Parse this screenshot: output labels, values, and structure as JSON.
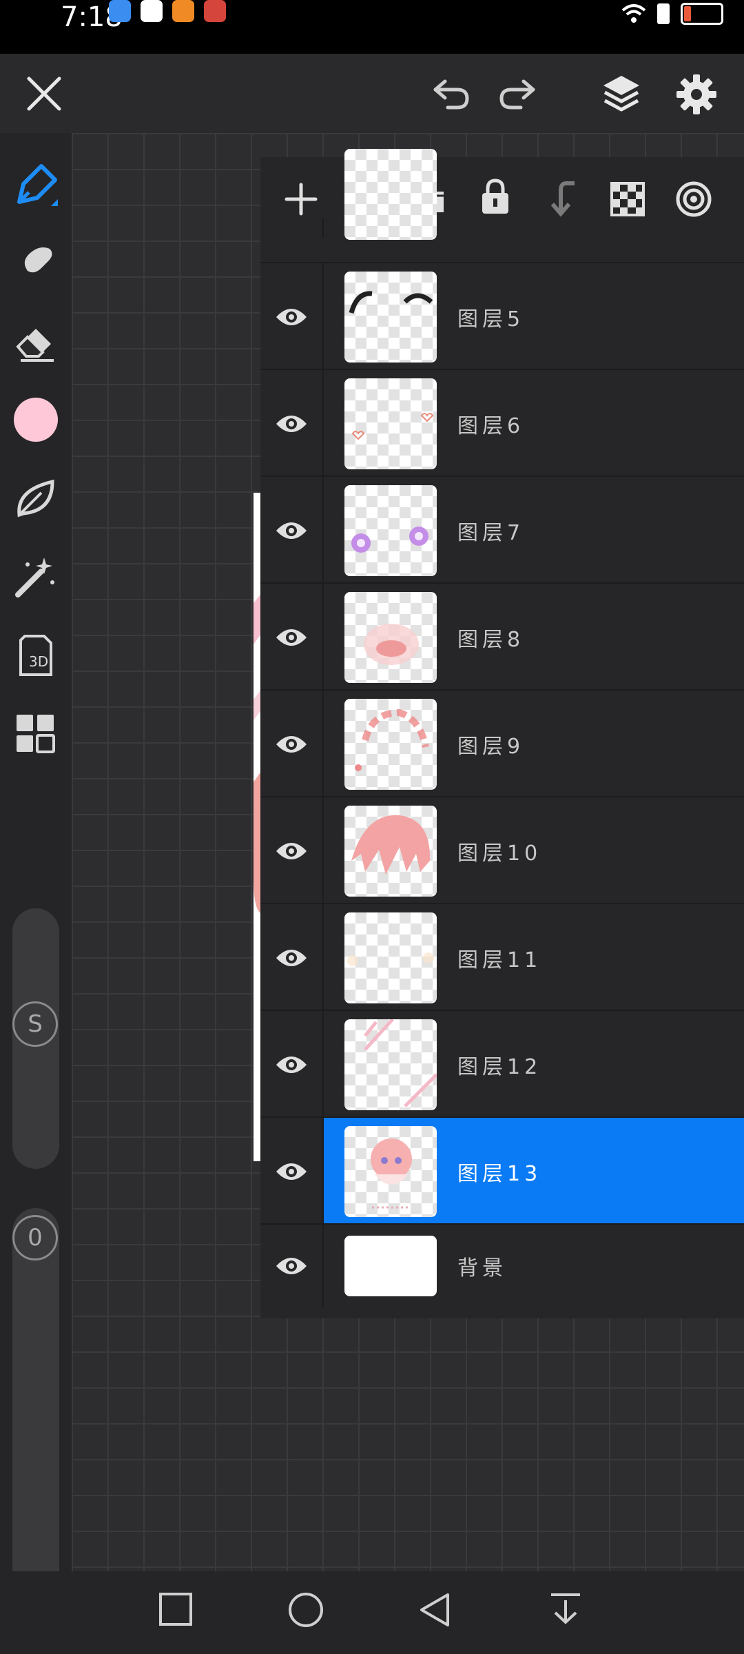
{
  "status_bar": {
    "time": "7:18"
  },
  "colors": {
    "accent": "#0a7bf5",
    "current_color": "#ffc8d8"
  },
  "toolbar": {
    "close_icon": "close-icon",
    "undo_icon": "undo-icon",
    "redo_icon": "redo-icon",
    "layers_icon": "layers-icon",
    "settings_icon": "gear-icon"
  },
  "left_tools": [
    {
      "name": "pen-tool"
    },
    {
      "name": "smudge-tool"
    },
    {
      "name": "eraser-tool"
    },
    {
      "name": "color-swatch"
    },
    {
      "name": "leaf-tool"
    },
    {
      "name": "magic-wand-tool"
    },
    {
      "name": "3d-tool"
    },
    {
      "name": "grid-tool"
    }
  ],
  "left_tools_3d_label": "3D",
  "size_slider": {
    "label": "S"
  },
  "opacity_slider": {
    "label": "0"
  },
  "layers_panel": {
    "actions": [
      "add-layer",
      "folder",
      "lock",
      "merge-down",
      "transparency",
      "clipping"
    ],
    "layers": [
      {
        "name": "图层5",
        "visible": true,
        "selected": false
      },
      {
        "name": "图层6",
        "visible": true,
        "selected": false
      },
      {
        "name": "图层7",
        "visible": true,
        "selected": false
      },
      {
        "name": "图层8",
        "visible": true,
        "selected": false
      },
      {
        "name": "图层9",
        "visible": true,
        "selected": false
      },
      {
        "name": "图层10",
        "visible": true,
        "selected": false
      },
      {
        "name": "图层11",
        "visible": true,
        "selected": false
      },
      {
        "name": "图层12",
        "visible": true,
        "selected": false
      },
      {
        "name": "图层13",
        "visible": true,
        "selected": true
      },
      {
        "name": "背景",
        "visible": true,
        "selected": false
      }
    ]
  }
}
